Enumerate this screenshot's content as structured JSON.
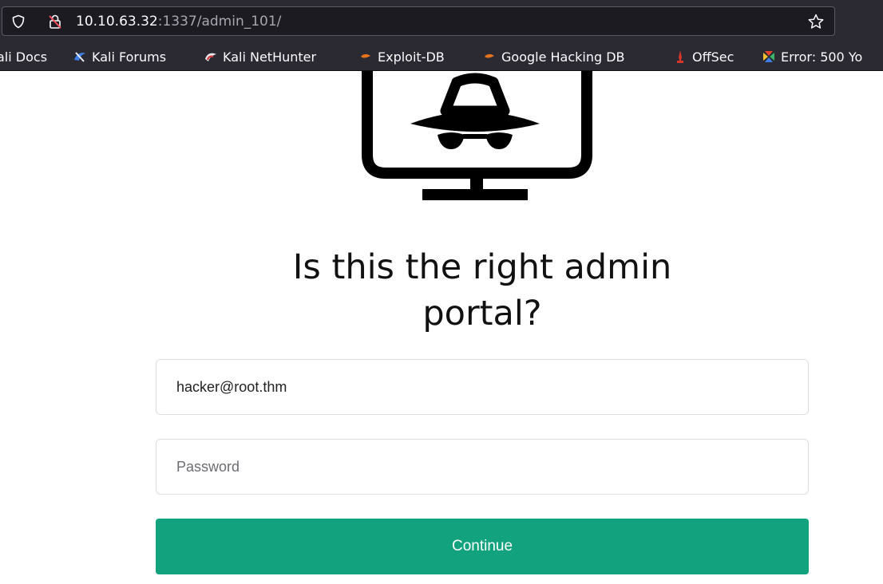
{
  "browser": {
    "url_host": "10.10.63.32",
    "url_path": ":1337/admin_101/",
    "icons": {
      "shield": "shield-icon",
      "insecure_lock": "insecure-lock-icon",
      "star": "star-bookmark-icon"
    }
  },
  "bookmarks": [
    {
      "label": "ali Docs",
      "icon": "kali-docs-icon"
    },
    {
      "label": "Kali Forums",
      "icon": "kali-forums-icon"
    },
    {
      "label": "Kali NetHunter",
      "icon": "kali-nethunter-icon"
    },
    {
      "label": "Exploit-DB",
      "icon": "exploit-db-icon"
    },
    {
      "label": "Google Hacking DB",
      "icon": "google-hacking-db-icon"
    },
    {
      "label": "OffSec",
      "icon": "offsec-icon"
    },
    {
      "label": "Error: 500 Yo",
      "icon": "error-page-icon"
    }
  ],
  "page": {
    "logo": "hacker-monitor-icon",
    "headline_line1": "Is this the right admin",
    "headline_line2": "portal?",
    "email_value": "hacker@root.thm",
    "password_placeholder": "Password",
    "continue_label": "Continue"
  },
  "colors": {
    "chrome_bg": "#2b2a33",
    "button_bg": "#12a27d",
    "text": "#111111"
  }
}
